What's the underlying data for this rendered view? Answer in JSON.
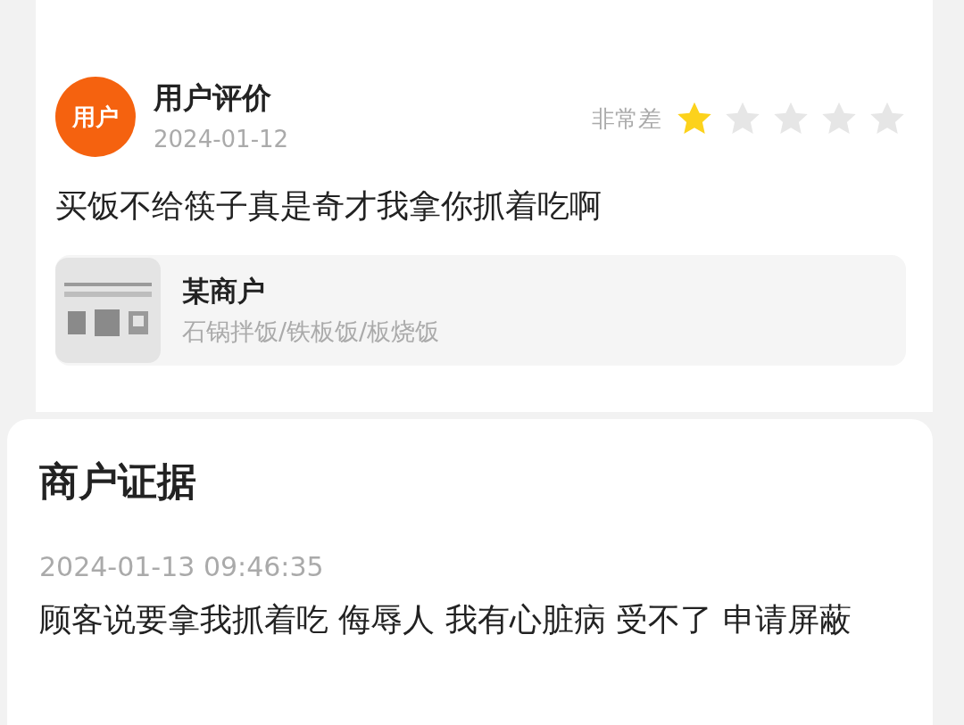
{
  "review": {
    "avatar": "用户",
    "title": "用户评价",
    "date": "2024-01-12",
    "rating_label": "非常差",
    "stars": 1,
    "text": "买饭不给筷子真是奇才我拿你抓着吃啊"
  },
  "merchant": {
    "name": "某商户",
    "category": "石锅拌饭/铁板饭/板烧饭"
  },
  "evidence": {
    "title": "商户证据",
    "timestamp": "2024-01-13 09:46:35",
    "text": "顾客说要拿我抓着吃 侮辱人 我有心脏病 受不了 申请屏蔽"
  }
}
